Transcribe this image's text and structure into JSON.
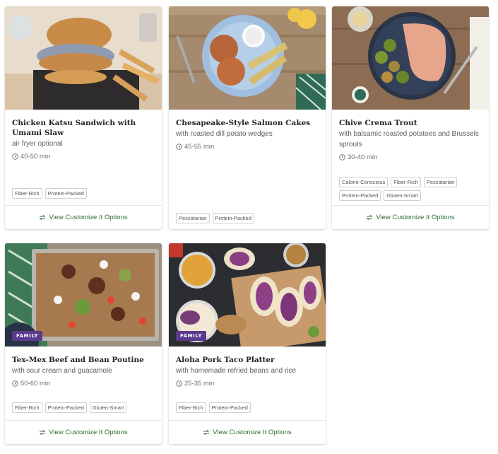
{
  "cards": [
    {
      "title": "Chicken Katsu Sandwich with Umami Slaw",
      "subtitle": "air fryer optional",
      "time": "40-50 min",
      "badge": "",
      "tags": [
        "Fiber-Rich",
        "Protein-Packed"
      ],
      "action": "View Customize It Options"
    },
    {
      "title": "Chesapeake-Style Salmon Cakes",
      "subtitle": "with roasted dill potato wedges",
      "time": "45-55 min",
      "badge": "",
      "tags": [
        "Pescatarian",
        "Protein-Packed"
      ],
      "action": ""
    },
    {
      "title": "Chive Crema Trout",
      "subtitle": "with balsamic roasted potatoes and Brussels sprouts",
      "time": "30-40 min",
      "badge": "",
      "tags": [
        "Calorie-Conscious",
        "Fiber-Rich",
        "Pescatarian",
        "Protein-Packed",
        "Gluten-Smart"
      ],
      "action": "View Customize It Options"
    },
    {
      "title": "Tex-Mex Beef and Bean Poutine",
      "subtitle": "with sour cream and guacamole",
      "time": "50-60 min",
      "badge": "FAMILY",
      "tags": [
        "Fiber-Rich",
        "Protein-Packed",
        "Gluten-Smart"
      ],
      "action": "View Customize It Options"
    },
    {
      "title": "Aloha Pork Taco Platter",
      "subtitle": "with homemade refried beans and rice",
      "time": "25-35 min",
      "badge": "FAMILY",
      "tags": [
        "Fiber-Rich",
        "Protein-Packed"
      ],
      "action": "View Customize It Options"
    }
  ],
  "icons": {
    "time": "clock-icon",
    "customize": "swap-arrows-icon"
  },
  "colors": {
    "accent_green": "#2c6b2f",
    "family_badge": "#5a3a8c"
  }
}
